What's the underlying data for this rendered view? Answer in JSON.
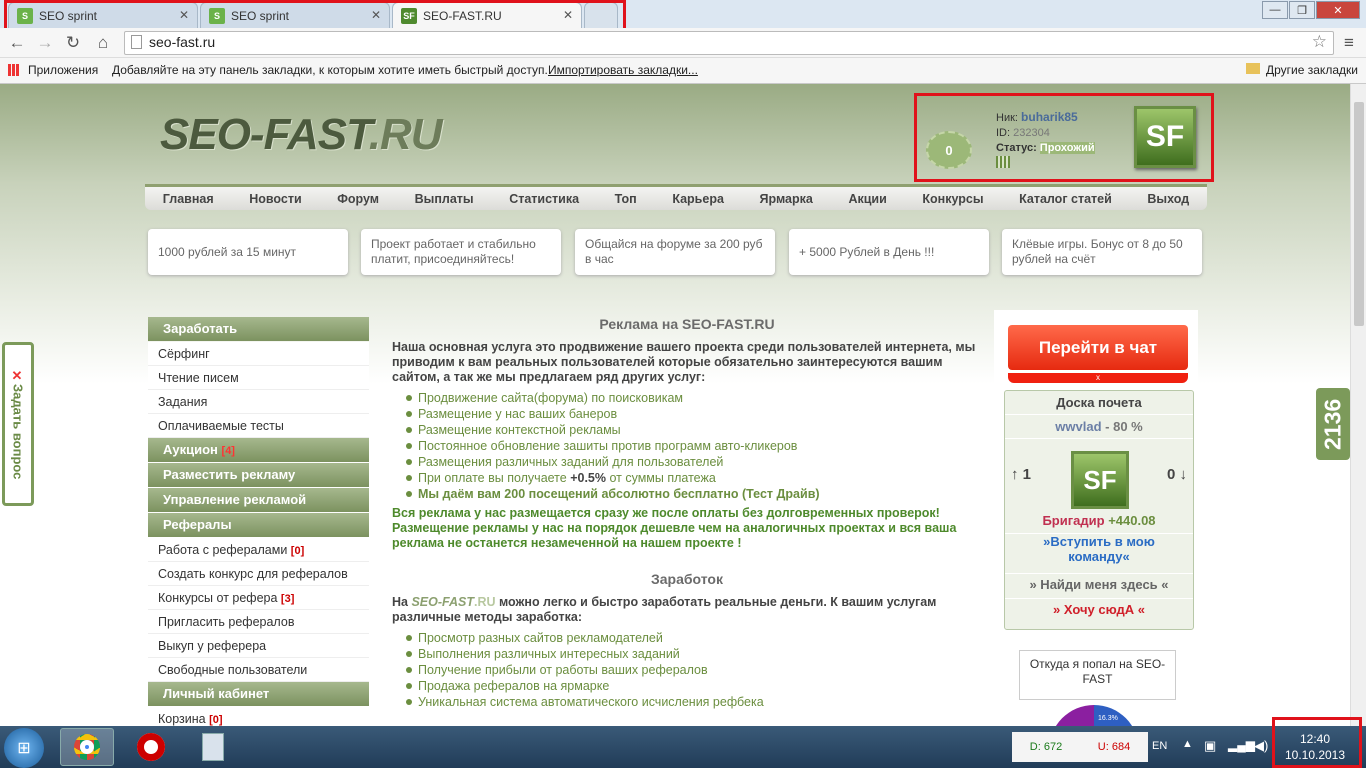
{
  "tabs": [
    {
      "label": "SEO sprint",
      "icon": "seosprint-icon"
    },
    {
      "label": "SEO sprint",
      "icon": "seosprint-icon"
    },
    {
      "label": "SEO-FAST.RU",
      "icon": "sf-icon"
    }
  ],
  "window": {
    "minimize": "—",
    "maximize": "❐",
    "close": "✕"
  },
  "address": {
    "url": "seo-fast.ru"
  },
  "bookmarks": {
    "apps": "Приложения",
    "hint": "Добавляйте на эту панель закладки, к которым хотите иметь быстрый доступ.",
    "import": "Импортировать закладки...",
    "other": "Другие закладки"
  },
  "header": {
    "logo_main": "SEO-FAST",
    "logo_ru": ".RU",
    "balance": "0",
    "nick_label": "Ник:",
    "nick": "buharik85",
    "id_label": "ID:",
    "id": "232304",
    "status_label": "Статус:",
    "status": "Прохожий",
    "avatar": "SF"
  },
  "nav": [
    "Главная",
    "Новости",
    "Форум",
    "Выплаты",
    "Статистика",
    "Топ",
    "Карьера",
    "Ярмарка",
    "Акции",
    "Конкурсы",
    "Каталог статей",
    "Выход"
  ],
  "promos": [
    "1000 рублей за 15 минут",
    "Проект работает и стабильно платит, присоединяйтесь!",
    "Общайся на форуме за 200 руб в час",
    "+ 5000 Рублей в День !!!",
    "Клёвые игры. Бонус от 8 до 50 рублей на счёт"
  ],
  "sidebar": {
    "earn": "Заработать",
    "surfing": "Сёрфинг",
    "mail": "Чтение писем",
    "tasks": "Задания",
    "tests": "Оплачиваемые тесты",
    "auction": "Аукцион",
    "auction_count": "[4]",
    "place_ad": "Разместить рекламу",
    "manage_ad": "Управление рекламой",
    "referrals": "Рефералы",
    "ref_work": "Работа с рефералами",
    "ref_work_count": "[0]",
    "ref_contest": "Создать конкурс для рефералов",
    "ref_contests": "Конкурсы от реферa",
    "ref_contests_count": "[3]",
    "invite": "Пригласить рефералов",
    "buyout": "Выкуп у реферера",
    "free_users": "Свободные пользователи",
    "cabinet": "Личный кабинет",
    "cart": "Корзина",
    "cart_count": "[0]"
  },
  "center": {
    "title1": "Реклама на SEO-FAST.RU",
    "intro1": "Наша основная услуга это продвижение вашего проекта среди пользователей интернета, мы приводим к вам реальных пользователей которые обязательно заинтересуются вашим сайтом, а так же мы предлагаем ряд других услуг:",
    "list1": [
      "Продвижение сайта(форума) по поисковикам",
      "Размещение у нас ваших банеров",
      "Размещение контекстной рекламы",
      "Постоянное обновление зашиты против программ авто-кликеров",
      "Размещения различных заданий для пользователей"
    ],
    "pay_pre": "При оплате вы получаете ",
    "pay_pct": "+0.5%",
    "pay_post": " от суммы платежа",
    "free_visits": "Мы даём вам 200 посещений абсолютно бесплатно (Тест Драйв)",
    "green_text": "Вся реклама у нас размещается сразу же после оплаты без долговременных проверок! Размещение рекламы у нас на порядок дешевле чем на аналогичных проектах и вся ваша реклама не останется незамеченной на нашем проекте !",
    "title2": "Заработок",
    "intro2_pre": "На ",
    "intro2_brand": "SEO-FAST",
    "intro2_ru": ".RU",
    "intro2_post": " можно легко и быстро заработать реальные деньги. К вашим услугам различные методы заработка:",
    "list2": [
      "Просмотр разных сайтов рекламодателей",
      "Выполнения различных интересных заданий",
      "Получение прибыли от работы ваших рефералов",
      "Продажа рефералов на ярмарке",
      "Уникальная система автоматического исчисления рефбека"
    ]
  },
  "right": {
    "chat": "Перейти в чат",
    "chat_close": "x",
    "board_title": "Доска почета",
    "leader": "wwvlad",
    "leader_pct": " - 80 %",
    "up": "↑ 1",
    "down": "0 ↓",
    "avatar": "SF",
    "rank": "Бригадир",
    "rank_value": "+440.08",
    "join": "»Вступить в мою команду«",
    "find": "» Найди меня здесь «",
    "want": "» Хочу сюдА «",
    "where_from": "Откуда я попал на SEO-FAST",
    "pie_label": "16.3%",
    "pie_share": 0.163
  },
  "float": {
    "ask": "Задать вопрос",
    "ask_close": "✕",
    "counter": "2136"
  },
  "taskbar": {
    "d": "D: 672",
    "u": "U: 684",
    "lang": "EN",
    "time": "12:40",
    "date": "10.10.2013"
  }
}
